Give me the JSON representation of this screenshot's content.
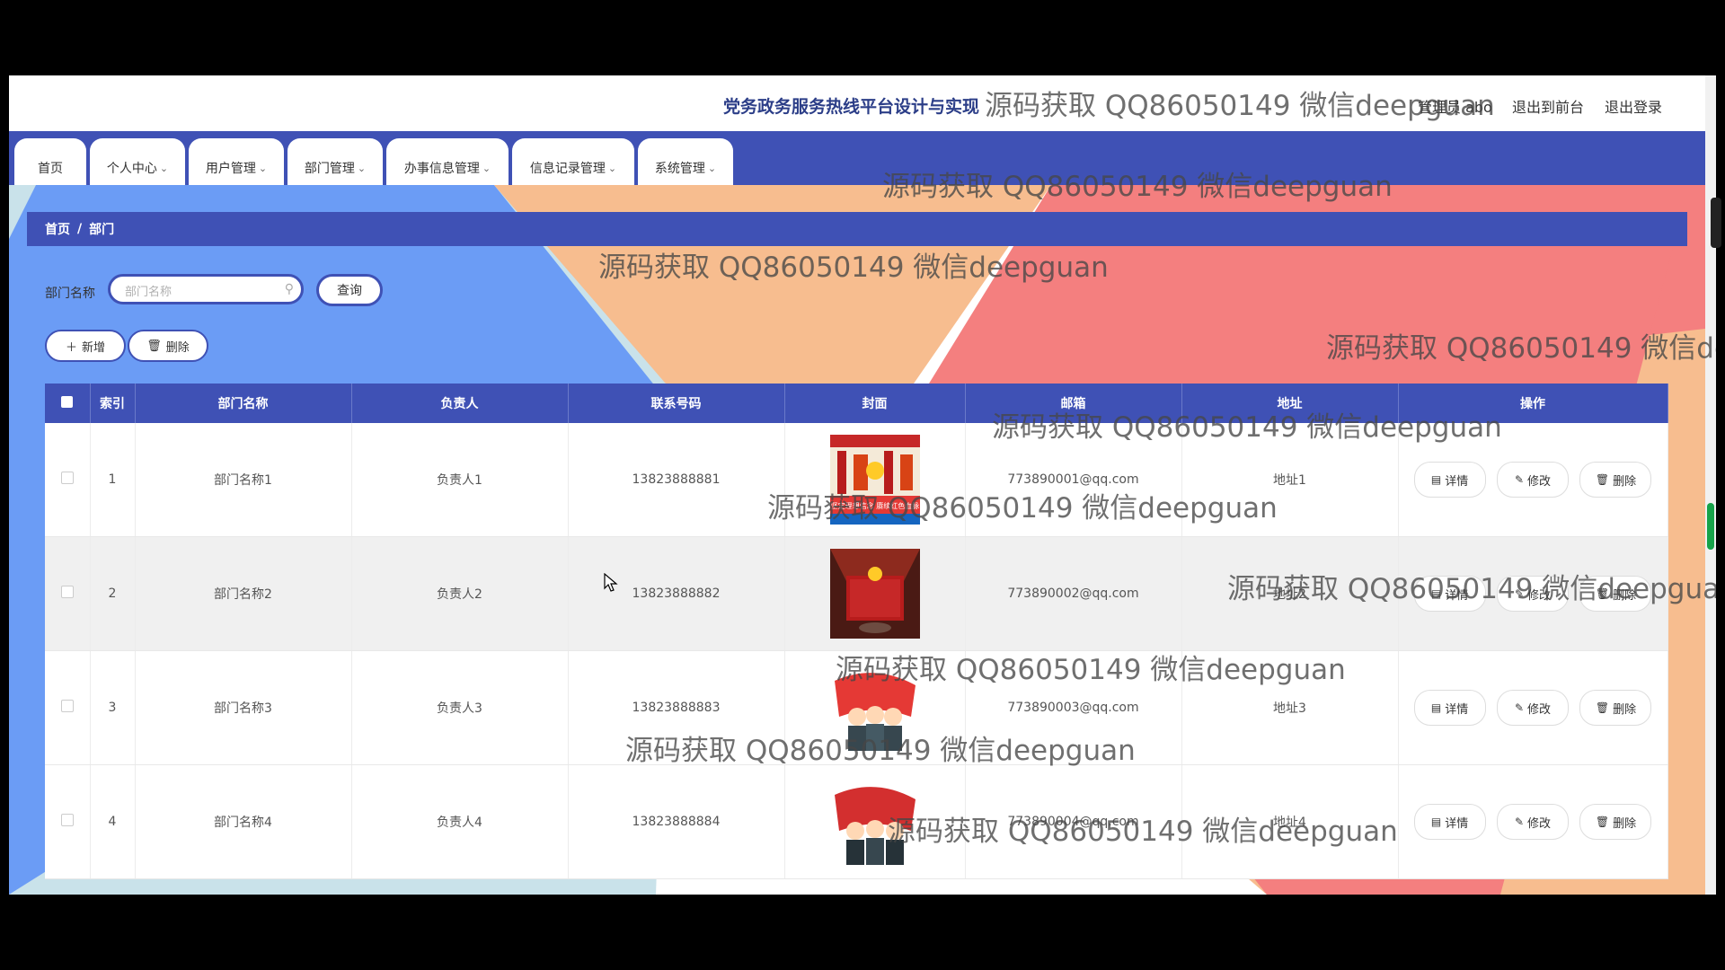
{
  "header": {
    "title": "党务政务服务热线平台设计与实现",
    "user_label": "管理员 abo",
    "link_front": "退出到前台",
    "link_logout": "退出登录"
  },
  "nav": {
    "items": [
      {
        "label": "首页"
      },
      {
        "label": "个人中心"
      },
      {
        "label": "用户管理"
      },
      {
        "label": "部门管理"
      },
      {
        "label": "办事信息管理"
      },
      {
        "label": "信息记录管理"
      },
      {
        "label": "系统管理"
      }
    ]
  },
  "breadcrumb": {
    "home": "首页",
    "separator": "/",
    "current": "部门"
  },
  "search": {
    "label": "部门名称",
    "placeholder": "部门名称",
    "query_label": "查询"
  },
  "toolbar": {
    "add_label": "新增",
    "delete_label": "删除"
  },
  "table": {
    "headers": [
      "索引",
      "部门名称",
      "负责人",
      "联系号码",
      "封面",
      "邮箱",
      "地址",
      "操作"
    ],
    "rows": [
      {
        "index": "1",
        "name": "部门名称1",
        "manager": "负责人1",
        "phone": "13823888881",
        "email": "773890001@qq.com",
        "address": "地址1",
        "cover_caption": "坚定理想信念 赓续红色血脉"
      },
      {
        "index": "2",
        "name": "部门名称2",
        "manager": "负责人2",
        "phone": "13823888882",
        "email": "773890002@qq.com",
        "address": "地址2",
        "cover_caption": ""
      },
      {
        "index": "3",
        "name": "部门名称3",
        "manager": "负责人3",
        "phone": "13823888883",
        "email": "773890003@qq.com",
        "address": "地址3",
        "cover_caption": ""
      },
      {
        "index": "4",
        "name": "部门名称4",
        "manager": "负责人4",
        "phone": "13823888884",
        "email": "773890004@qq.com",
        "address": "地址4",
        "cover_caption": ""
      }
    ],
    "actions": {
      "detail": "详情",
      "edit": "修改",
      "delete": "删除"
    }
  },
  "watermark_text": "源码获取 QQ86050149 微信deepguan",
  "colors": {
    "primary": "#3f51b5",
    "bg_blue": "#6b9cf5",
    "bg_peach": "#f7bd8f",
    "bg_red": "#f47f7f",
    "bg_light": "#c9e2ea"
  }
}
